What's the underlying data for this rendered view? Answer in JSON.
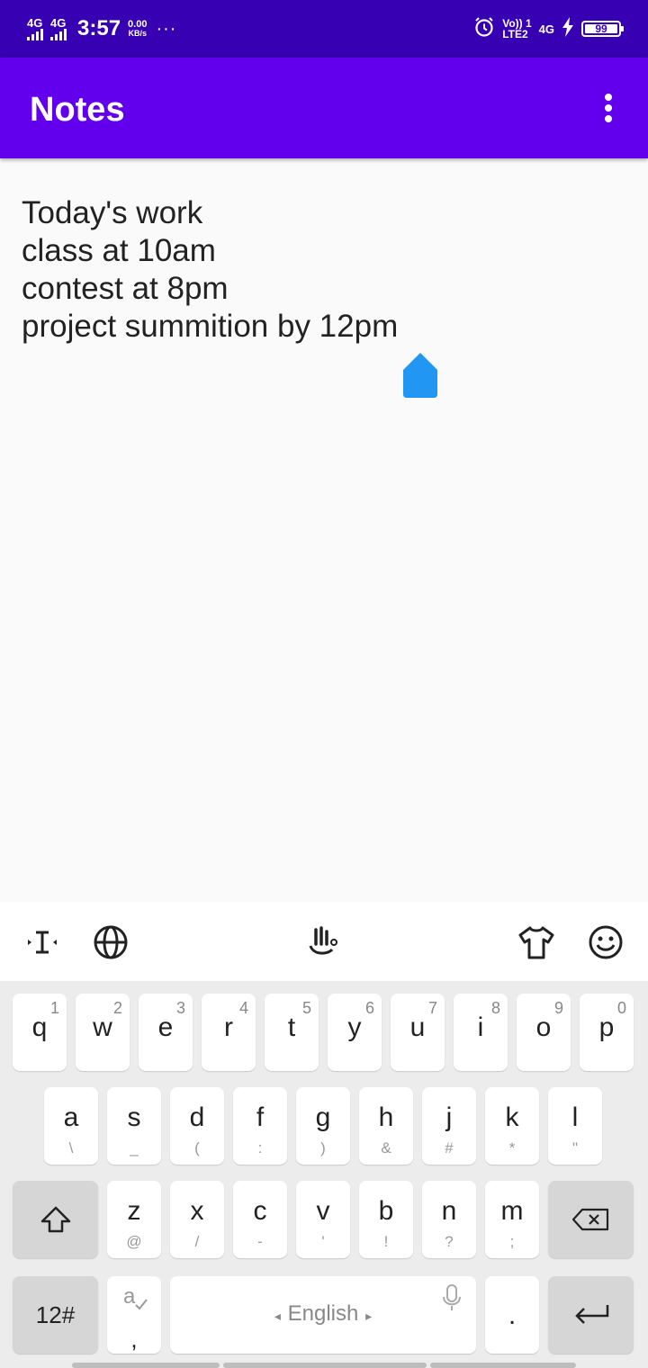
{
  "status_bar": {
    "sim1_network": "4G",
    "sim2_network": "4G",
    "time": "3:57",
    "speed_value": "0.00",
    "speed_unit": "KB/s",
    "more": "···",
    "volte_top": "Vo)) 1",
    "volte_bottom": "LTE2",
    "network_right": "4G",
    "battery_level": "99",
    "icons": [
      "signal-icon",
      "alarm-icon",
      "charging-icon",
      "battery-icon"
    ]
  },
  "app_bar": {
    "title": "Notes",
    "menu_icon": "more-vert-icon",
    "color": "#6200ee"
  },
  "note": {
    "lines": [
      "Today's work",
      "class at 10am",
      "contest at 8pm",
      "project summition by 12pm"
    ]
  },
  "keyboard": {
    "toolbar_icons": [
      "text-cursor-icon",
      "globe-icon",
      "gesture-typing-icon",
      "theme-shirt-icon",
      "emoji-icon"
    ],
    "row1": [
      {
        "key": "q",
        "alt": "1"
      },
      {
        "key": "w",
        "alt": "2"
      },
      {
        "key": "e",
        "alt": "3"
      },
      {
        "key": "r",
        "alt": "4"
      },
      {
        "key": "t",
        "alt": "5"
      },
      {
        "key": "y",
        "alt": "6"
      },
      {
        "key": "u",
        "alt": "7"
      },
      {
        "key": "i",
        "alt": "8"
      },
      {
        "key": "o",
        "alt": "9"
      },
      {
        "key": "p",
        "alt": "0"
      }
    ],
    "row2": [
      {
        "key": "a",
        "alt": "\\"
      },
      {
        "key": "s",
        "alt": "_"
      },
      {
        "key": "d",
        "alt": "("
      },
      {
        "key": "f",
        "alt": ":"
      },
      {
        "key": "g",
        "alt": ")"
      },
      {
        "key": "h",
        "alt": "&"
      },
      {
        "key": "j",
        "alt": "#"
      },
      {
        "key": "k",
        "alt": "*"
      },
      {
        "key": "l",
        "alt": "\""
      }
    ],
    "row3": [
      {
        "key": "z",
        "alt": "@"
      },
      {
        "key": "x",
        "alt": "/"
      },
      {
        "key": "c",
        "alt": "-"
      },
      {
        "key": "v",
        "alt": "'"
      },
      {
        "key": "b",
        "alt": "!"
      },
      {
        "key": "n",
        "alt": "?"
      },
      {
        "key": "m",
        "alt": ";"
      }
    ],
    "numbers_key": "12#",
    "comma_key": ",",
    "space_label": "English",
    "period_key": ".",
    "accent_color": "#2196f3"
  }
}
